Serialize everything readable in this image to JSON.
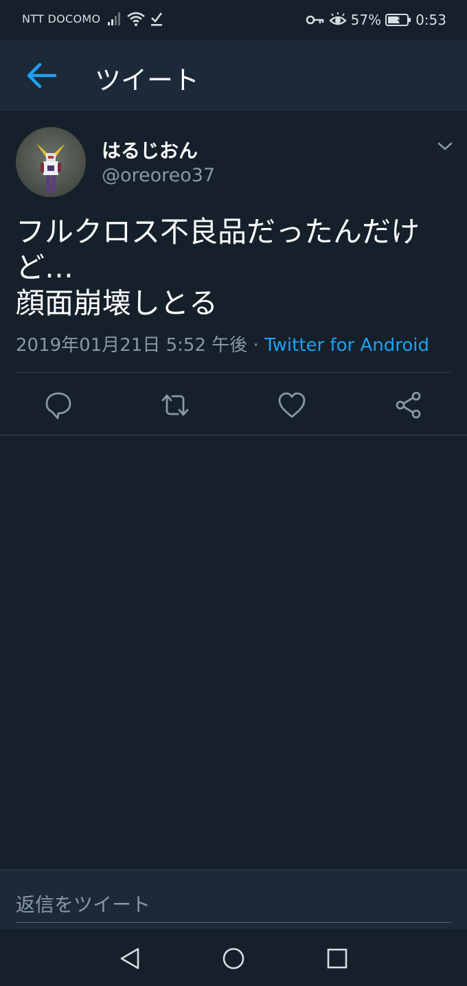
{
  "status_bar": {
    "carrier": "NTT DOCOMO",
    "battery": "57%",
    "time": "0:53",
    "icons": [
      "signal-icon",
      "wifi-icon",
      "check-icon",
      "key-icon",
      "eye-icon",
      "battery-icon"
    ]
  },
  "app_bar": {
    "title": "ツイート",
    "back_icon": "arrow-left-icon",
    "accent_color": "#1da1f2"
  },
  "tweet": {
    "display_name": "はるじおん",
    "handle": "@oreoreo37",
    "text_lines": [
      "フルクロス不良品だったんだけ",
      "ど…",
      "顔面崩壊しとる"
    ],
    "timestamp": "2019年01月21日 5:52 午後",
    "separator": "·",
    "source": "Twitter for Android",
    "actions": [
      "reply-icon",
      "retweet-icon",
      "like-icon",
      "share-icon"
    ]
  },
  "reply": {
    "placeholder": "返信をツイート"
  },
  "nav": {
    "icons": [
      "nav-back-icon",
      "nav-home-icon",
      "nav-recents-icon"
    ]
  },
  "colors": {
    "background": "#15202b",
    "bar": "#1c2938",
    "secondary_text": "#8899a6",
    "link": "#1da1f2"
  }
}
